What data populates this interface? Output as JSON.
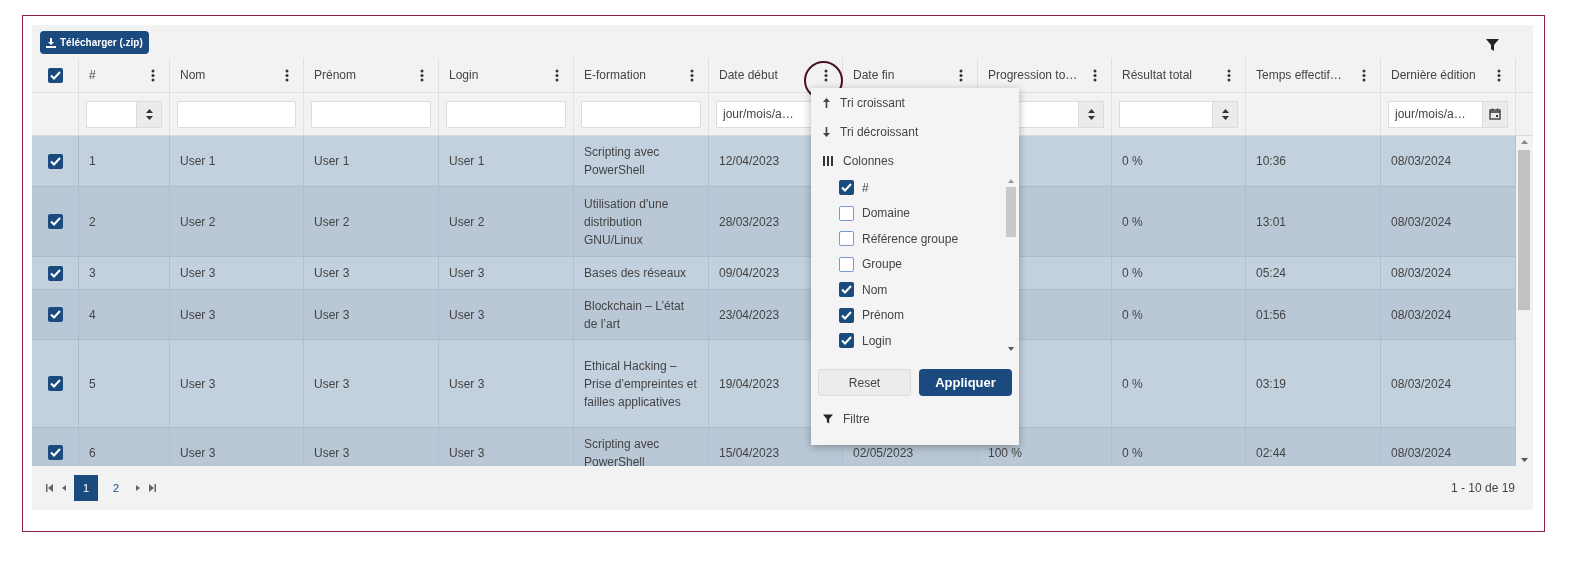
{
  "toolbar": {
    "download_label": "Télécharger (.zip)"
  },
  "select_all": {
    "checked": true
  },
  "columns": [
    {
      "label": "#",
      "filter": {
        "kind": "number"
      }
    },
    {
      "label": "Nom",
      "filter": {
        "kind": "text"
      }
    },
    {
      "label": "Prénom",
      "filter": {
        "kind": "text"
      }
    },
    {
      "label": "Login",
      "filter": {
        "kind": "text"
      }
    },
    {
      "label": "E-formation",
      "filter": {
        "kind": "text"
      }
    },
    {
      "label": "Date début",
      "filter": {
        "kind": "date",
        "placeholder": "jour/mois/a…"
      }
    },
    {
      "label": "Date fin"
    },
    {
      "label": "Progression to…",
      "filter": {
        "kind": "number"
      }
    },
    {
      "label": "Résultat total",
      "filter": {
        "kind": "number"
      }
    },
    {
      "label": "Temps effectif…"
    },
    {
      "label": "Dernière édition",
      "filter": {
        "kind": "datepicker",
        "placeholder": "jour/mois/a…"
      }
    }
  ],
  "rows": [
    {
      "selected": true,
      "cells": [
        "1",
        "User 1",
        "User 1",
        "User 1",
        "Scripting avec PowerShell",
        "12/04/2023",
        null,
        null,
        "0 %",
        "10:36",
        "08/03/2024"
      ]
    },
    {
      "selected": true,
      "cells": [
        "2",
        "User 2",
        "User 2",
        "User 2",
        "Utilisation d'une distribution GNU/Linux",
        "28/03/2023",
        null,
        null,
        "0 %",
        "13:01",
        "08/03/2024"
      ]
    },
    {
      "selected": true,
      "cells": [
        "3",
        "User 3",
        "User 3",
        "User 3",
        "Bases des réseaux",
        "09/04/2023",
        null,
        null,
        "0 %",
        "05:24",
        "08/03/2024"
      ]
    },
    {
      "selected": true,
      "cells": [
        "4",
        "User 3",
        "User 3",
        "User 3",
        "Blockchain – L’état de l’art",
        "23/04/2023",
        null,
        null,
        "0 %",
        "01:56",
        "08/03/2024"
      ]
    },
    {
      "selected": true,
      "cells": [
        "5",
        "User 3",
        "User 3",
        "User 3",
        "Ethical Hacking – Prise d’empreintes et failles applicatives",
        "19/04/2023",
        null,
        null,
        "0 %",
        "03:19",
        "08/03/2024"
      ]
    },
    {
      "selected": true,
      "cells": [
        "6",
        "User 3",
        "User 3",
        "User 3",
        "Scripting avec PowerShell",
        "15/04/2023",
        "02/05/2023",
        "100 %",
        "0 %",
        "02:44",
        "08/03/2024"
      ]
    }
  ],
  "column_menu": {
    "sort_ascending": "Tri croissant",
    "sort_descending": "Tri décroissant",
    "columns_heading": "Colonnes",
    "column_options": [
      {
        "label": "#",
        "checked": true
      },
      {
        "label": "Domaine",
        "checked": false
      },
      {
        "label": "Référence groupe",
        "checked": false
      },
      {
        "label": "Groupe",
        "checked": false
      },
      {
        "label": "Nom",
        "checked": true
      },
      {
        "label": "Prénom",
        "checked": true
      },
      {
        "label": "Login",
        "checked": true
      }
    ],
    "reset_label": "Reset",
    "apply_label": "Appliquer",
    "filter_label": "Filtre"
  },
  "pager": {
    "pages": [
      {
        "label": "1",
        "selected": true
      },
      {
        "label": "2",
        "selected": false
      }
    ],
    "range": "1 - 10 de 19"
  }
}
